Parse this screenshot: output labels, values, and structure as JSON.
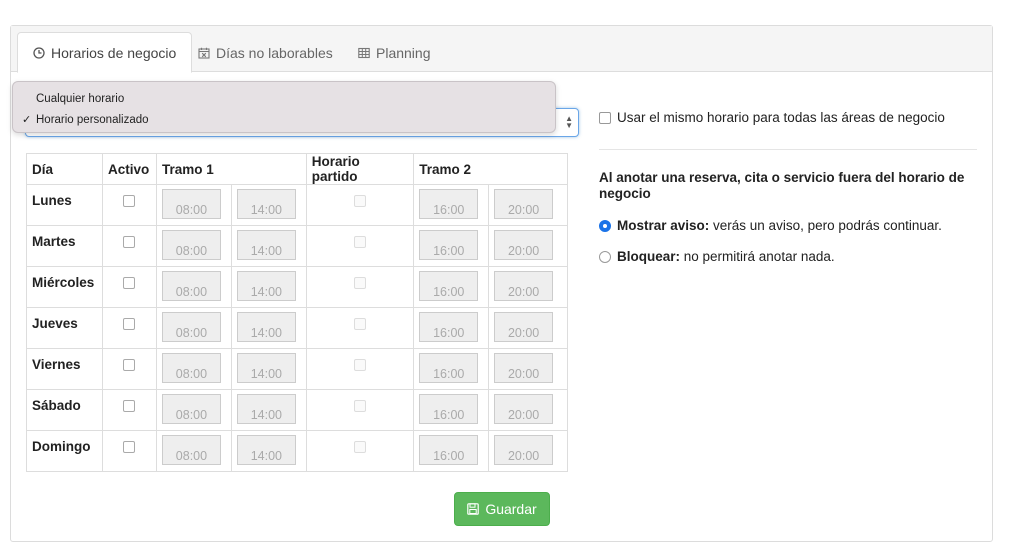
{
  "tabs": [
    {
      "label": "Horarios de negocio",
      "icon": "clock-icon",
      "active": true
    },
    {
      "label": "Días no laborables",
      "icon": "calendar-x-icon",
      "active": false
    },
    {
      "label": "Planning",
      "icon": "table-icon",
      "active": false
    }
  ],
  "select": {
    "options": [
      "Cualquier horario",
      "Horario personalizado"
    ],
    "selected": "Horario personalizado"
  },
  "table": {
    "headers": [
      "Día",
      "Activo",
      "Tramo 1",
      "Horario partido",
      "Tramo 2"
    ],
    "rows": [
      {
        "day": "Lunes",
        "t1_from": "08:00",
        "t1_to": "14:00",
        "t2_from": "16:00",
        "t2_to": "20:00"
      },
      {
        "day": "Martes",
        "t1_from": "08:00",
        "t1_to": "14:00",
        "t2_from": "16:00",
        "t2_to": "20:00"
      },
      {
        "day": "Miércoles",
        "t1_from": "08:00",
        "t1_to": "14:00",
        "t2_from": "16:00",
        "t2_to": "20:00"
      },
      {
        "day": "Jueves",
        "t1_from": "08:00",
        "t1_to": "14:00",
        "t2_from": "16:00",
        "t2_to": "20:00"
      },
      {
        "day": "Viernes",
        "t1_from": "08:00",
        "t1_to": "14:00",
        "t2_from": "16:00",
        "t2_to": "20:00"
      },
      {
        "day": "Sábado",
        "t1_from": "08:00",
        "t1_to": "14:00",
        "t2_from": "16:00",
        "t2_to": "20:00"
      },
      {
        "day": "Domingo",
        "t1_from": "08:00",
        "t1_to": "14:00",
        "t2_from": "16:00",
        "t2_to": "20:00"
      }
    ]
  },
  "right": {
    "same_schedule_label": "Usar el mismo horario para todas las áreas de negocio",
    "heading": "Al anotar una reserva, cita o servicio fuera del horario de negocio",
    "option_warn_bold": "Mostrar aviso:",
    "option_warn_text": " verás un aviso, pero podrás continuar.",
    "option_block_bold": "Bloquear:",
    "option_block_text": " no permitirá anotar nada."
  },
  "save_label": "Guardar",
  "colors": {
    "accent": "#5cb85c",
    "radio": "#1a73e8"
  }
}
